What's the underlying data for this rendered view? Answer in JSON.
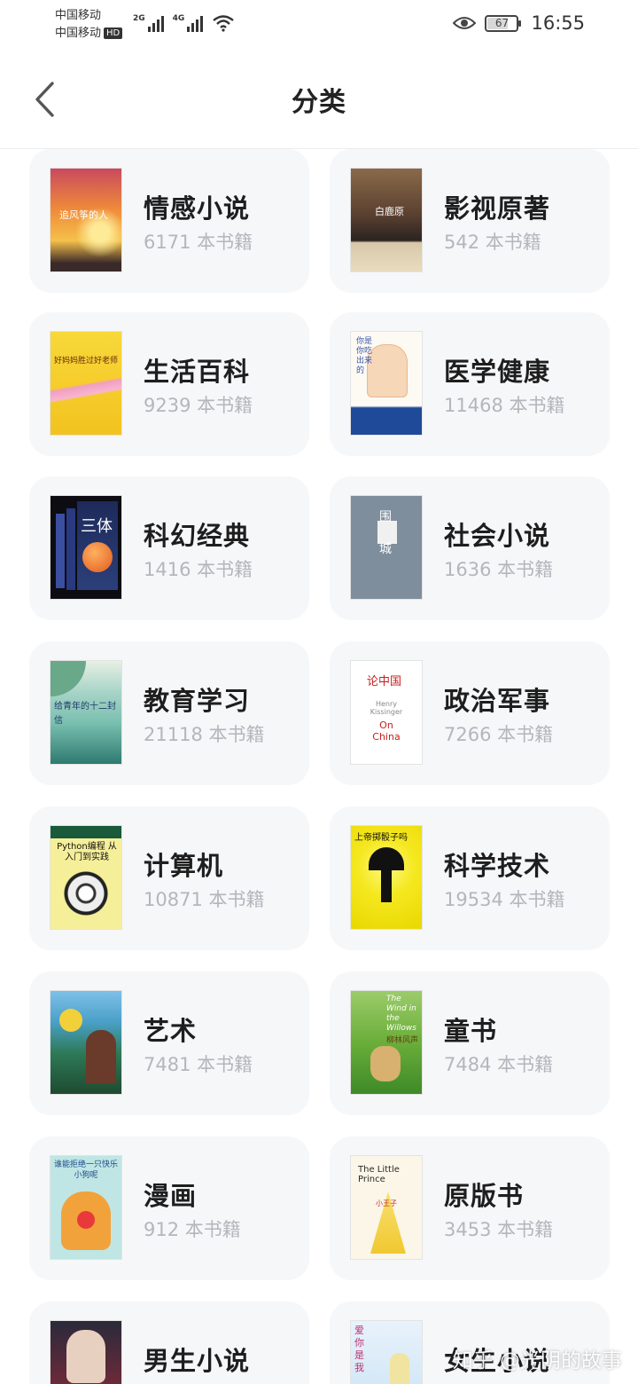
{
  "status": {
    "carrier1": "中国移动",
    "carrier2": "中国移动",
    "hd": "HD",
    "net1": "2G",
    "net2": "4G",
    "battery": "67",
    "time": "16:55"
  },
  "header": {
    "title": "分类"
  },
  "categories": [
    {
      "name": "情感小说",
      "count": "6171 本书籍"
    },
    {
      "name": "影视原著",
      "count": "542 本书籍"
    },
    {
      "name": "生活百科",
      "count": "9239 本书籍"
    },
    {
      "name": "医学健康",
      "count": "11468 本书籍"
    },
    {
      "name": "科幻经典",
      "count": "1416 本书籍"
    },
    {
      "name": "社会小说",
      "count": "1636 本书籍"
    },
    {
      "name": "教育学习",
      "count": "21118 本书籍"
    },
    {
      "name": "政治军事",
      "count": "7266 本书籍"
    },
    {
      "name": "计算机",
      "count": "10871 本书籍"
    },
    {
      "name": "科学技术",
      "count": "19534 本书籍"
    },
    {
      "name": "艺术",
      "count": "7481 本书籍"
    },
    {
      "name": "童书",
      "count": "7484 本书籍"
    },
    {
      "name": "漫画",
      "count": "912 本书籍"
    },
    {
      "name": "原版书",
      "count": "3453 本书籍"
    },
    {
      "name": "男生小说",
      "count": ""
    },
    {
      "name": "女生小说",
      "count": ""
    }
  ],
  "covers": [
    {
      "title": "追风筝的人"
    },
    {
      "title": "白鹿原"
    },
    {
      "title": "好妈妈胜过好老师"
    },
    {
      "title": "你是你吃出来的"
    },
    {
      "title": "三体"
    },
    {
      "title": "围城"
    },
    {
      "title": "给青年的十二封信"
    },
    {
      "title": "论中国",
      "en1": "Henry Kissinger",
      "en2": "On China"
    },
    {
      "title": "Python编程 从入门到实践"
    },
    {
      "title": "上帝掷骰子吗"
    },
    {
      "title": ""
    },
    {
      "title": "The Wind in the Willows",
      "sub": "柳林风声"
    },
    {
      "title": "谁能拒绝一只快乐小狗呢"
    },
    {
      "title": "The Little Prince",
      "sub": "小王子"
    },
    {
      "title": ""
    },
    {
      "title": "爱你是我"
    }
  ],
  "watermark": "知乎 @光阴的故事"
}
